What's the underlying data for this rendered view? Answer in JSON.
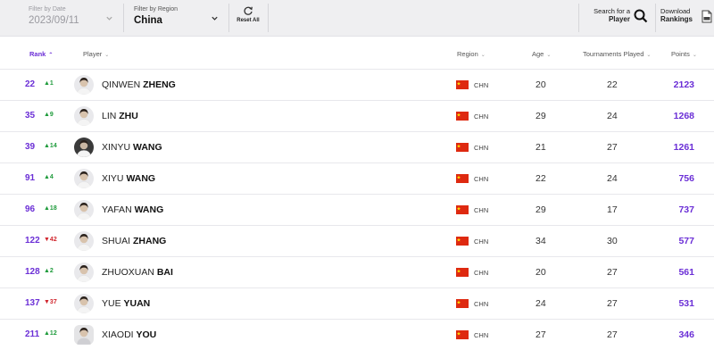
{
  "filters": {
    "date": {
      "label": "Filter by Date",
      "value": "2023/09/11"
    },
    "region": {
      "label": "Filter by Region",
      "value": "China"
    },
    "reset_label": "Reset All",
    "search": {
      "line1": "Search for a",
      "line2": "Player"
    },
    "download": {
      "line1": "Download",
      "line2": "Rankings"
    }
  },
  "columns": {
    "rank": "Rank",
    "player": "Player",
    "region": "Region",
    "age": "Age",
    "tournaments": "Tournaments Played",
    "points": "Points"
  },
  "colors": {
    "accent": "#6b2fd6",
    "up": "#1d9a3a",
    "down": "#d0242c",
    "flag_red": "#de2910",
    "flag_star": "#ffde00"
  },
  "rows": [
    {
      "rank": "22",
      "move": "▲1",
      "dir": "up",
      "first": "QINWEN",
      "last": "ZHENG",
      "country": "CHN",
      "age": "20",
      "tournaments": "22",
      "points": "2123"
    },
    {
      "rank": "35",
      "move": "▲9",
      "dir": "up",
      "first": "LIN",
      "last": "ZHU",
      "country": "CHN",
      "age": "29",
      "tournaments": "24",
      "points": "1268"
    },
    {
      "rank": "39",
      "move": "▲14",
      "dir": "up",
      "first": "XINYU",
      "last": "WANG",
      "country": "CHN",
      "age": "21",
      "tournaments": "27",
      "points": "1261"
    },
    {
      "rank": "91",
      "move": "▲4",
      "dir": "up",
      "first": "XIYU",
      "last": "WANG",
      "country": "CHN",
      "age": "22",
      "tournaments": "24",
      "points": "756"
    },
    {
      "rank": "96",
      "move": "▲18",
      "dir": "up",
      "first": "YAFAN",
      "last": "WANG",
      "country": "CHN",
      "age": "29",
      "tournaments": "17",
      "points": "737"
    },
    {
      "rank": "122",
      "move": "▼42",
      "dir": "down",
      "first": "SHUAI",
      "last": "ZHANG",
      "country": "CHN",
      "age": "34",
      "tournaments": "30",
      "points": "577"
    },
    {
      "rank": "128",
      "move": "▲2",
      "dir": "up",
      "first": "ZHUOXUAN",
      "last": "BAI",
      "country": "CHN",
      "age": "20",
      "tournaments": "27",
      "points": "561"
    },
    {
      "rank": "137",
      "move": "▼37",
      "dir": "down",
      "first": "YUE",
      "last": "YUAN",
      "country": "CHN",
      "age": "24",
      "tournaments": "27",
      "points": "531"
    },
    {
      "rank": "211",
      "move": "▲12",
      "dir": "up",
      "first": "XIAODI",
      "last": "YOU",
      "country": "CHN",
      "age": "27",
      "tournaments": "27",
      "points": "346"
    }
  ]
}
